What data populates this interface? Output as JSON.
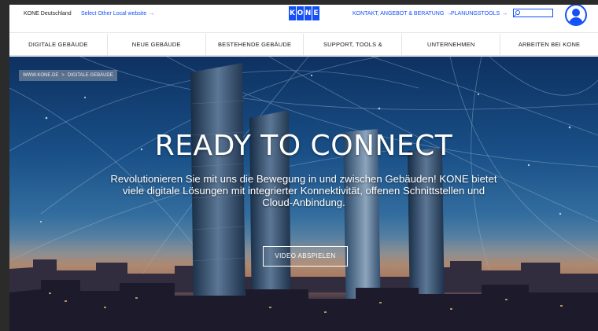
{
  "topbar": {
    "country": "KONE Deutschland",
    "select_site": "Select Other Local website",
    "arrow": "→",
    "logo_letters": [
      "K",
      "O",
      "N",
      "E"
    ],
    "contact": "KONTAKT, ANGEBOT & BERATUNG",
    "planning": "PLANUNGSTOOLS",
    "search_placeholder": ""
  },
  "nav": {
    "items": [
      "DIGITALE GEBÄUDE",
      "NEUE GEBÄUDE",
      "BESTEHENDE GEBÄUDE",
      "SUPPORT, TOOLS & DOWNLOADS",
      "UNTERNEHMEN",
      "ARBEITEN BEI KONE"
    ]
  },
  "breadcrumb": {
    "home": "WWW.KONE.DE",
    "separator": ">",
    "current": "DIGITALE GEBÄUDE"
  },
  "hero": {
    "title": "READY TO CONNECT",
    "text": "Revolutionieren Sie mit uns die Bewegung in und zwischen Gebäuden! KONE bietet viele digitale Lösungen mit integrierter Konnektivität, offenen Schnittstellen und Cloud-Anbindung.",
    "button": "VIDEO ABSPIELEN"
  },
  "colors": {
    "brand_blue": "#1450f5",
    "frame_dark": "#2b2b2b"
  }
}
